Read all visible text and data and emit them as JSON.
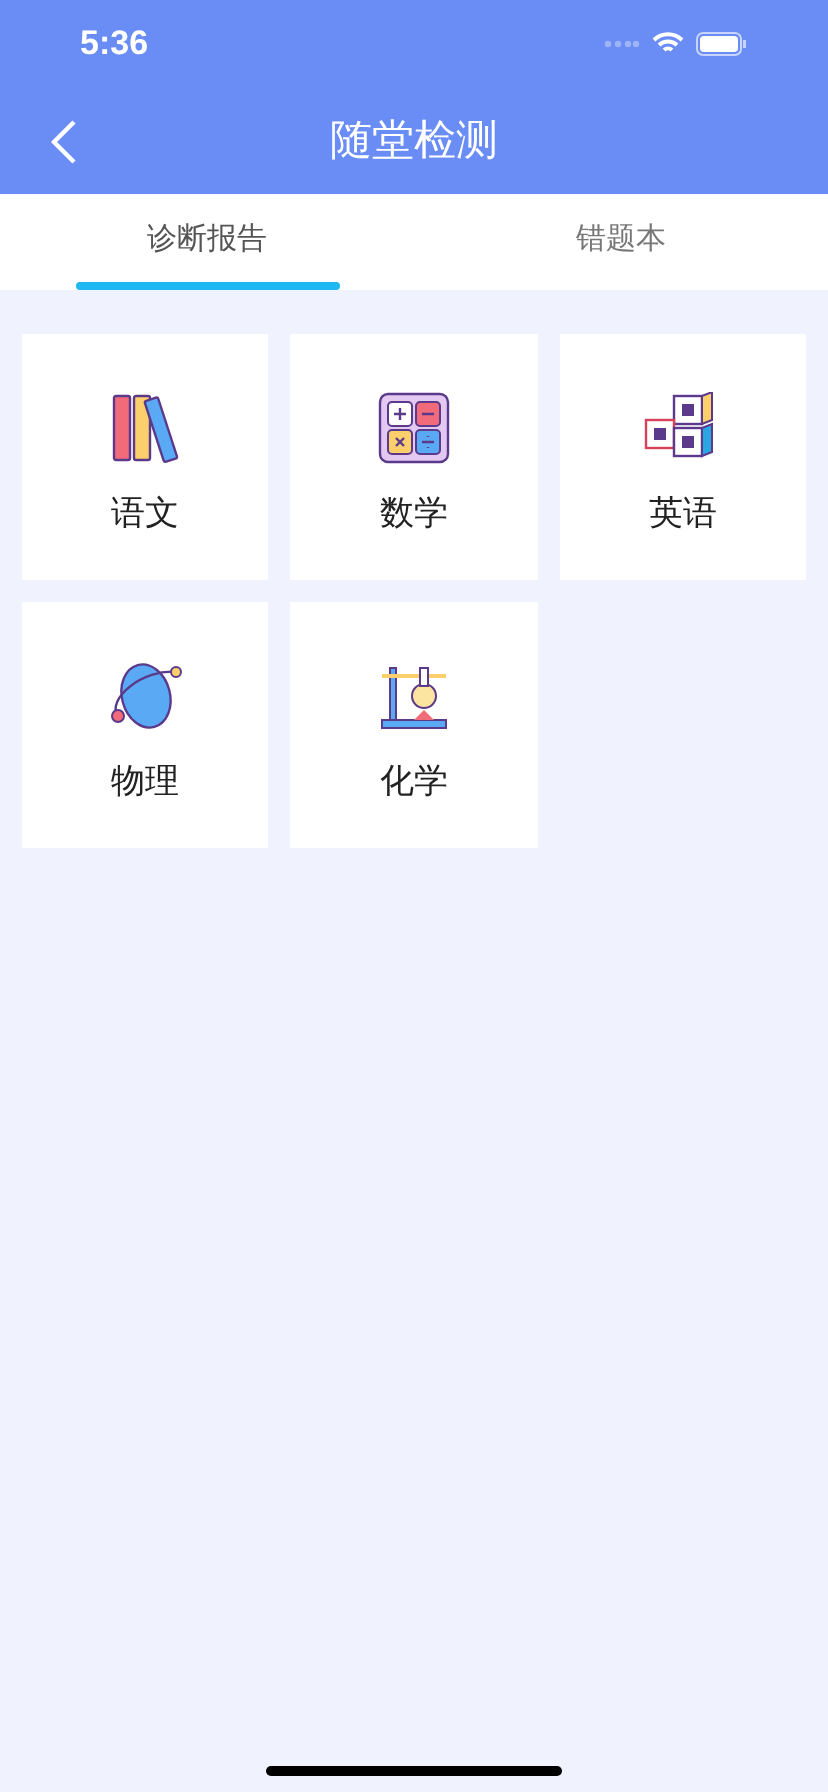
{
  "status_bar": {
    "time": "5:36"
  },
  "nav": {
    "title": "随堂检测"
  },
  "tabs": [
    {
      "label": "诊断报告",
      "selected": true
    },
    {
      "label": "错题本",
      "selected": false
    }
  ],
  "subjects": [
    {
      "label": "语文",
      "kind": "books"
    },
    {
      "label": "数学",
      "kind": "calculator"
    },
    {
      "label": "英语",
      "kind": "blocks"
    },
    {
      "label": "物理",
      "kind": "planet"
    },
    {
      "label": "化学",
      "kind": "lab"
    }
  ]
}
